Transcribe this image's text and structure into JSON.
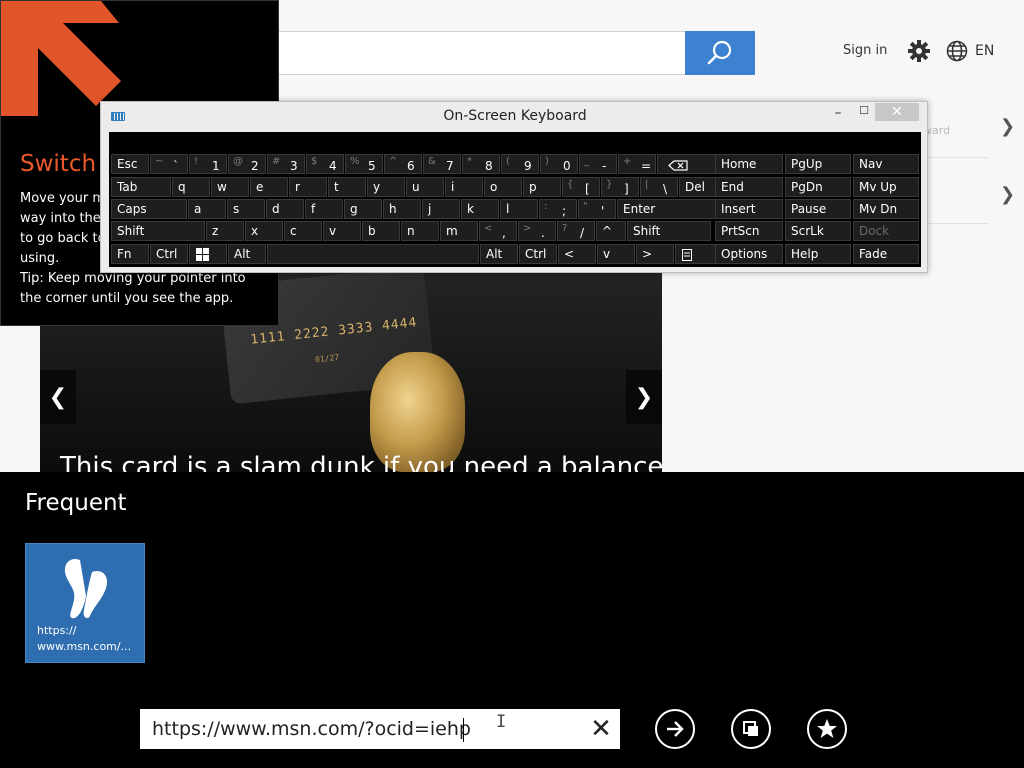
{
  "msn": {
    "sign_in": "Sign in",
    "language": "EN",
    "side_faint": "ward",
    "hero_caption": "This card is a slam dunk if you need a balance",
    "card_number": "1111 2222 3333 4444",
    "card_expiry": "01/27"
  },
  "switch_tip": {
    "title": "Switch",
    "lines": [
      "Move your m",
      "way into the",
      "to go back to",
      "using.",
      "Tip: Keep moving your pointer into",
      "the corner until you see the app."
    ]
  },
  "osk": {
    "title": "On-Screen Keyboard",
    "rows": [
      [
        {
          "label": "Esc"
        },
        {
          "shift": "~",
          "main": "`"
        },
        {
          "shift": "!",
          "main": "1"
        },
        {
          "shift": "@",
          "main": "2"
        },
        {
          "shift": "#",
          "main": "3"
        },
        {
          "shift": "$",
          "main": "4"
        },
        {
          "shift": "%",
          "main": "5"
        },
        {
          "shift": "^",
          "main": "6"
        },
        {
          "shift": "&",
          "main": "7"
        },
        {
          "shift": "*",
          "main": "8"
        },
        {
          "shift": "(",
          "main": "9"
        },
        {
          "shift": ")",
          "main": "0"
        },
        {
          "shift": "_",
          "main": "-"
        },
        {
          "shift": "+",
          "main": "="
        },
        {
          "icon": "backspace-icon"
        }
      ],
      [
        {
          "label": "Tab"
        },
        {
          "label": "q"
        },
        {
          "label": "w"
        },
        {
          "label": "e"
        },
        {
          "label": "r"
        },
        {
          "label": "t"
        },
        {
          "label": "y"
        },
        {
          "label": "u"
        },
        {
          "label": "i"
        },
        {
          "label": "o"
        },
        {
          "label": "p"
        },
        {
          "shift": "{",
          "main": "["
        },
        {
          "shift": "}",
          "main": "]"
        },
        {
          "shift": "|",
          "main": "\\"
        },
        {
          "label": "Del"
        }
      ],
      [
        {
          "label": "Caps"
        },
        {
          "label": "a"
        },
        {
          "label": "s"
        },
        {
          "label": "d"
        },
        {
          "label": "f"
        },
        {
          "label": "g"
        },
        {
          "label": "h"
        },
        {
          "label": "j"
        },
        {
          "label": "k"
        },
        {
          "label": "l"
        },
        {
          "shift": ":",
          "main": ";"
        },
        {
          "shift": "\"",
          "main": "'"
        },
        {
          "label": "Enter"
        }
      ],
      [
        {
          "label": "Shift"
        },
        {
          "label": "z"
        },
        {
          "label": "x"
        },
        {
          "label": "c"
        },
        {
          "label": "v"
        },
        {
          "label": "b"
        },
        {
          "label": "n"
        },
        {
          "label": "m"
        },
        {
          "shift": "<",
          "main": ","
        },
        {
          "shift": ">",
          "main": "."
        },
        {
          "shift": "?",
          "main": "/"
        },
        {
          "label": "^"
        },
        {
          "label": "Shift"
        }
      ],
      [
        {
          "label": "Fn"
        },
        {
          "label": "Ctrl"
        },
        {
          "icon": "windows-logo-icon"
        },
        {
          "label": "Alt"
        },
        {
          "label": ""
        },
        {
          "label": "Alt"
        },
        {
          "label": "Ctrl"
        },
        {
          "label": "<"
        },
        {
          "label": "v"
        },
        {
          "label": ">"
        },
        {
          "icon": "menu-icon"
        }
      ]
    ],
    "nav_keys": [
      [
        "Home",
        "PgUp",
        "Nav"
      ],
      [
        "End",
        "PgDn",
        "Mv Up"
      ],
      [
        "Insert",
        "Pause",
        "Mv Dn"
      ],
      [
        "PrtScn",
        "ScrLk",
        "Dock"
      ],
      [
        "Options",
        "Help",
        "Fade"
      ]
    ]
  },
  "appbar": {
    "frequent_label": "Frequent",
    "tile": {
      "url_line1": "https://",
      "url_line2": "www.msn.com/...",
      "icon": "msn-butterfly-icon"
    },
    "address": "https://www.msn.com/?ocid=iehp"
  }
}
